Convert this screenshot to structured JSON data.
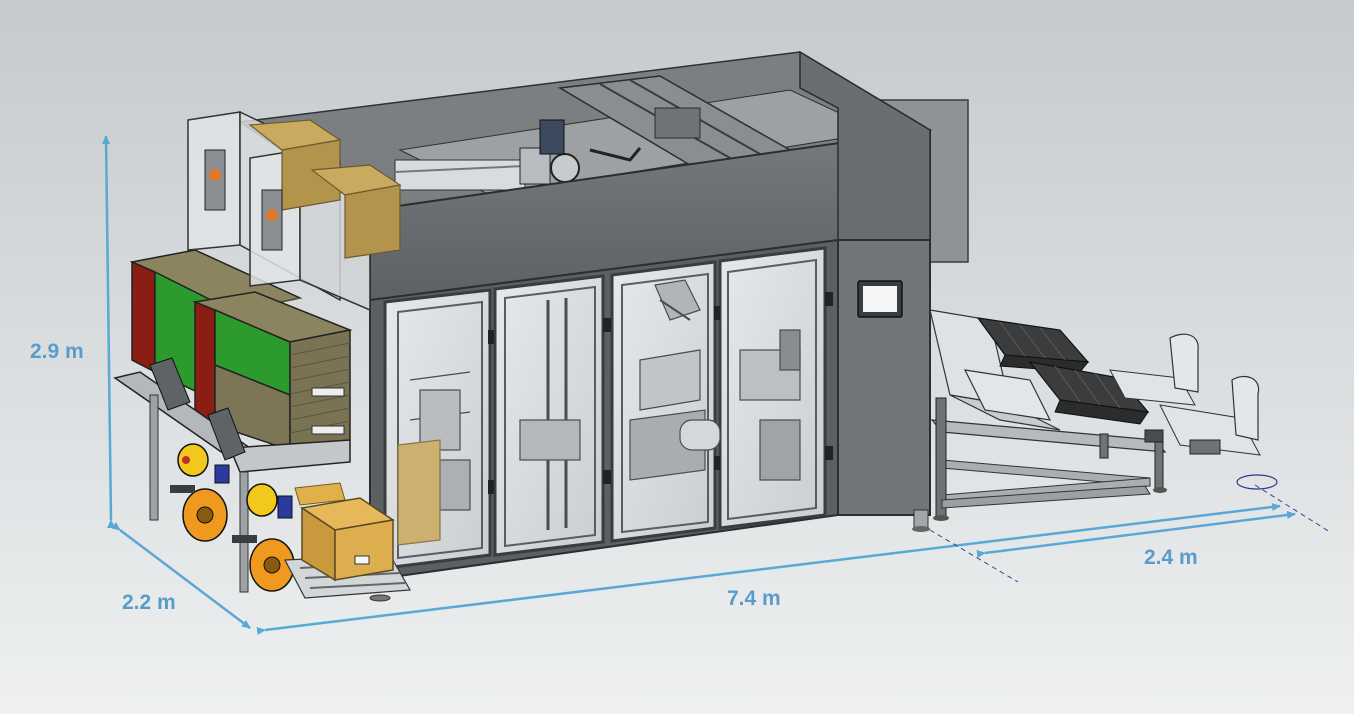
{
  "dimensions": {
    "height": "2.9 m",
    "depth": "2.2 m",
    "length": "7.4 m",
    "conveyor_length": "2.4 m"
  },
  "colors": {
    "dimension_line": "#5aa8d4",
    "label": "#5a9cc8",
    "background_top": "#c9cdd0",
    "background_bottom": "#eef0f1",
    "enclosure": "#6a6d70",
    "enclosure_dark": "#4f5255",
    "glass": "#dfe3e6",
    "carton": "#c9aa5e",
    "carton_dark": "#a8893f",
    "box_yellow": "#e2b04a",
    "reel_yellow": "#f2c81c",
    "reel_orange": "#ef9a1e",
    "panel_red": "#8a1d14",
    "panel_green": "#2c9a2c",
    "magazine": "#7c7556"
  }
}
